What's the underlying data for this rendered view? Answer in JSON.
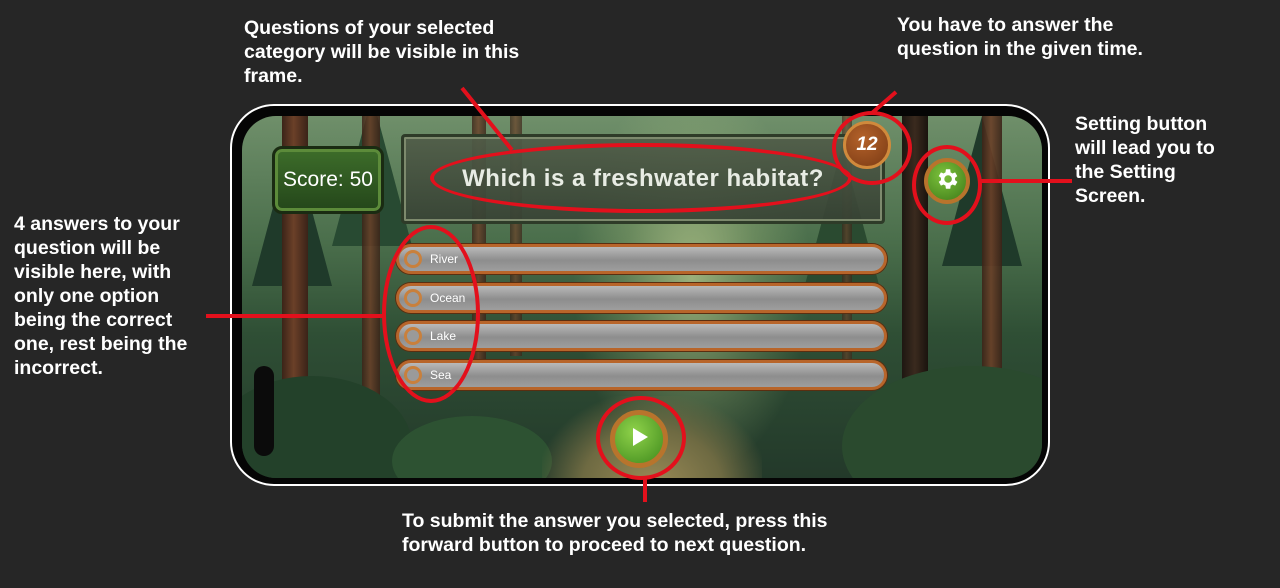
{
  "annotations": {
    "question": "Questions of your selected\ncategory will be visible in this\nframe.",
    "timer": "You have to answer the\nquestion in the given time.",
    "settings": "Setting button\nwill lead you to\nthe Setting\nScreen.",
    "answers": "4 answers to your\nquestion will be\nvisible here, with\nonly one option\nbeing the correct\none, rest being the\nincorrect.",
    "submit": "To submit the answer you selected, press this\nforward button to proceed to next question."
  },
  "game": {
    "score_label": "Score: 50",
    "question": "Which is a freshwater habitat?",
    "timer": "12",
    "answers": [
      "River",
      "Ocean",
      "Lake",
      "Sea"
    ]
  },
  "icons": {
    "settings": "gear-icon",
    "submit": "play-icon",
    "timer": "timer-badge"
  },
  "colors": {
    "annotation_red": "#e3101c",
    "button_green": "#5fae2c",
    "frame_orange": "#b8652a",
    "background": "#262626"
  }
}
